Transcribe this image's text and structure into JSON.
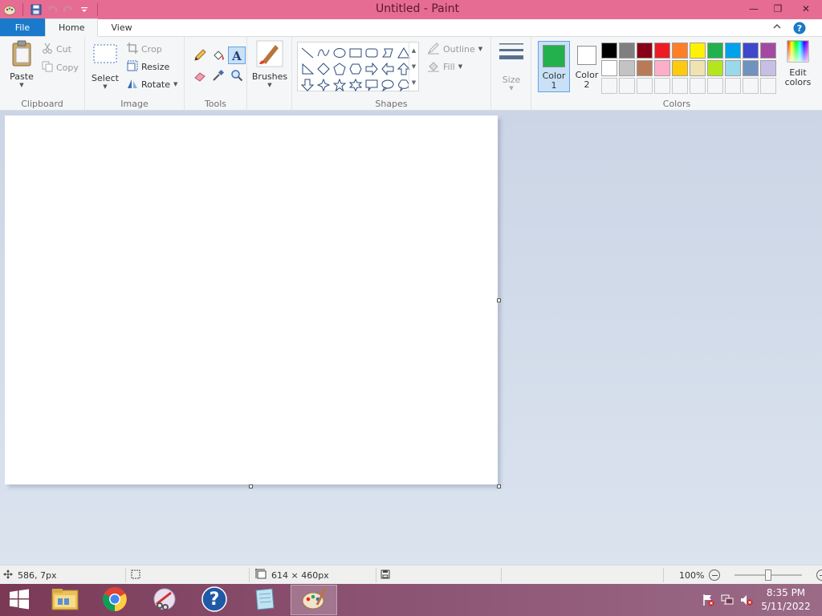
{
  "window": {
    "title": "Untitled - Paint",
    "minimize": "—",
    "restore": "❐",
    "close": "✕"
  },
  "tabs": [
    {
      "label": "File"
    },
    {
      "label": "Home"
    },
    {
      "label": "View"
    }
  ],
  "clipboard": {
    "paste": "Paste",
    "cut": "Cut",
    "copy": "Copy",
    "group": "Clipboard"
  },
  "image": {
    "select": "Select",
    "crop": "Crop",
    "resize": "Resize",
    "rotate": "Rotate",
    "group": "Image"
  },
  "tools": {
    "group": "Tools",
    "items": [
      "pencil-icon",
      "fill-icon",
      "text-icon",
      "eraser-icon",
      "color-picker-icon",
      "magnifier-icon"
    ]
  },
  "brushes": {
    "label": "Brushes"
  },
  "shapes": {
    "outline": "Outline",
    "fill": "Fill",
    "group": "Shapes"
  },
  "size": {
    "label": "Size"
  },
  "colors": {
    "color1_label": "Color",
    "color1_num": "1",
    "color2_label": "Color",
    "color2_num": "2",
    "edit_label": "Edit",
    "edit_label2": "colors",
    "group": "Colors",
    "color1": "#22b14c",
    "color2": "#ffffff",
    "palette_row1": [
      "#000000",
      "#7f7f7f",
      "#880015",
      "#ed1c24",
      "#ff7f27",
      "#fff200",
      "#22b14c",
      "#00a2e8",
      "#3f48cc",
      "#a349a4"
    ],
    "palette_row2": [
      "#ffffff",
      "#c3c3c3",
      "#b97a57",
      "#ffaec9",
      "#ffc90e",
      "#efe4b0",
      "#b5e61d",
      "#99d9ea",
      "#7092be",
      "#c8bfe7"
    ]
  },
  "status": {
    "cursor_pos": "586, 7px",
    "canvas_size": "614 × 460px",
    "zoom": "100%"
  },
  "taskbar": {
    "time": "8:35 PM",
    "date": "5/11/2022"
  }
}
